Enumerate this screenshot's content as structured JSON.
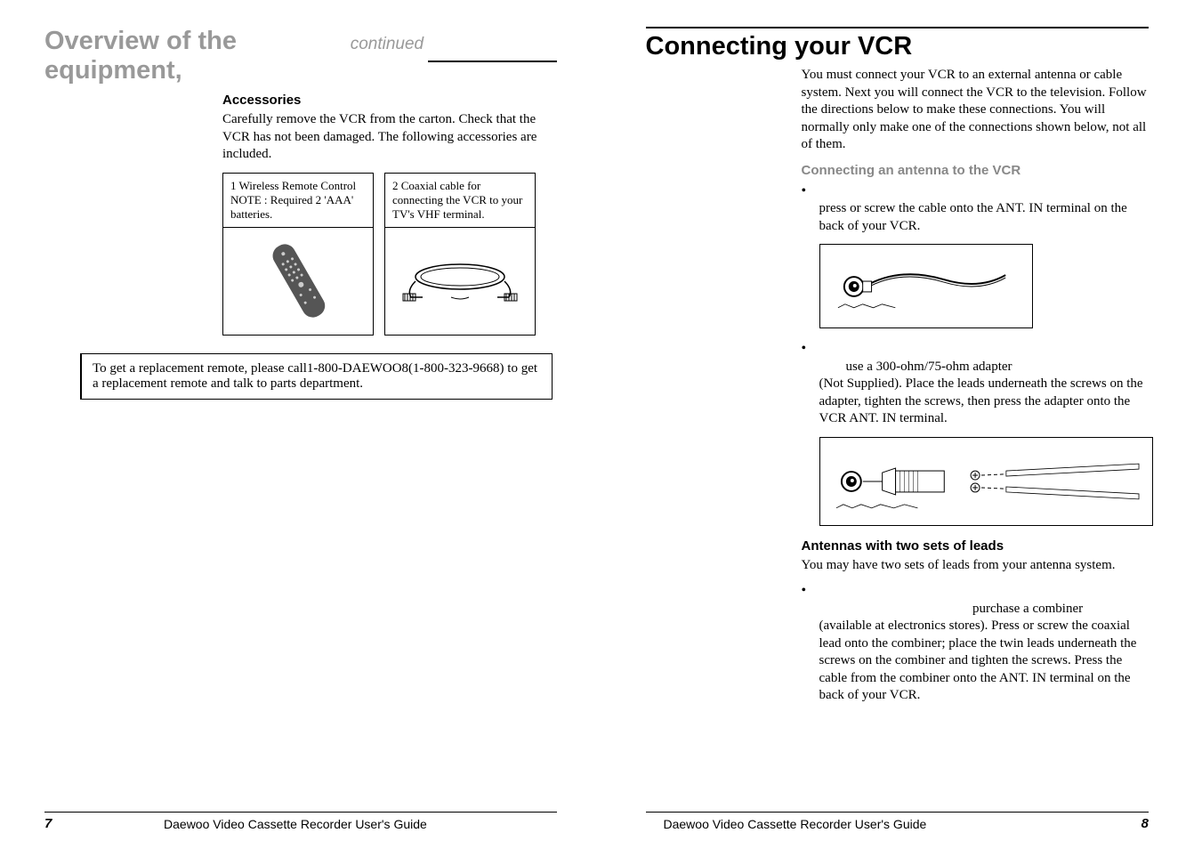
{
  "left_page": {
    "title_main": "Overview of the equipment,",
    "title_sub": "continued",
    "accessories": {
      "heading": "Accessories",
      "intro": "Carefully remove the VCR from the carton. Check that the VCR has not been damaged. The following accessories are included.",
      "box1": "1  Wireless Remote Control NOTE : Required  2 'AAA' batteries.",
      "box2": "2  Coaxial cable for connecting the VCR to your TV's  VHF terminal."
    },
    "note": "To get a replacement remote, please call1-800-DAEWOO8(1-800-323-9668) to get a replacement remote and talk to parts department.",
    "footer_guide": "Daewoo Video Cassette Recorder User's Guide",
    "page_num": "7"
  },
  "right_page": {
    "title": "Connecting your VCR",
    "intro": "You must connect your VCR to an external antenna or cable system. Next you will connect the VCR to the television. Follow the directions below to make these connections. You will normally only make one of the connections shown below, not all of them.",
    "sub_heading": "Connecting an antenna to the VCR",
    "bullet1": "press or screw the cable onto the ANT. IN terminal on the back of your VCR.",
    "bullet2_lead": "use a 300-ohm/75-ohm adapter",
    "bullet2_rest": "(Not Supplied). Place the leads underneath the screws on the adapter, tighten the screws, then press the adapter onto the VCR  ANT. IN  terminal.",
    "antennas_heading": "Antennas with two sets of leads",
    "antennas_intro": "You may have two sets of leads from your antenna system.",
    "bullet3_lead": "purchase a combiner",
    "bullet3_rest": "(available at electronics stores). Press or screw the coaxial lead onto the combiner; place the twin leads underneath the screws on the combiner and tighten the screws. Press the cable from the combiner onto the ANT. IN terminal on the back of your VCR.",
    "footer_guide": "Daewoo Video Cassette Recorder User's Guide",
    "page_num": "8"
  }
}
